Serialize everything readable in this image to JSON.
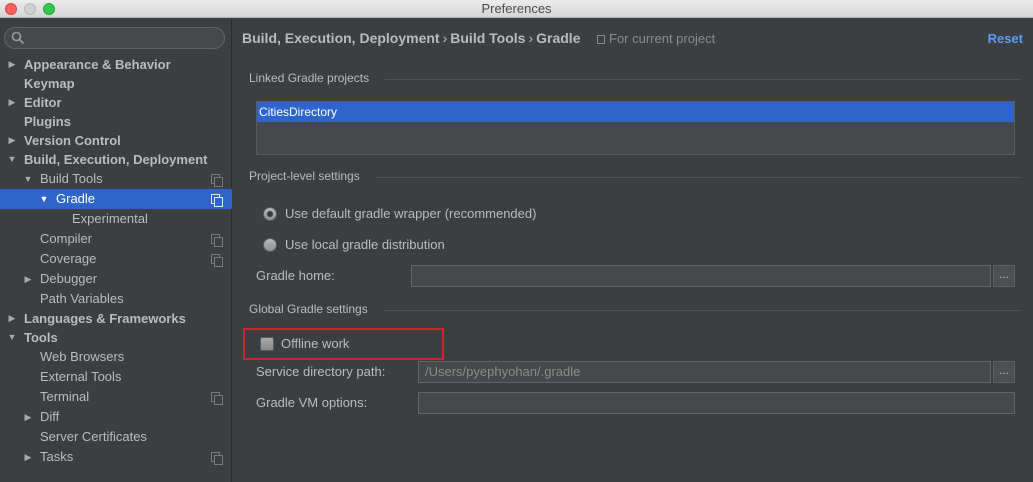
{
  "window": {
    "title": "Preferences"
  },
  "search": {
    "placeholder": "",
    "icon": "search-icon"
  },
  "sidebar": {
    "items": [
      {
        "label": "Appearance & Behavior",
        "bold": true,
        "arrow": "right",
        "indent": 0
      },
      {
        "label": "Keymap",
        "bold": true,
        "arrow": "",
        "indent": 0
      },
      {
        "label": "Editor",
        "bold": true,
        "arrow": "right",
        "indent": 0
      },
      {
        "label": "Plugins",
        "bold": true,
        "arrow": "",
        "indent": 0
      },
      {
        "label": "Version Control",
        "bold": true,
        "arrow": "right",
        "indent": 0
      },
      {
        "label": "Build, Execution, Deployment",
        "bold": true,
        "arrow": "down",
        "indent": 0
      },
      {
        "label": "Build Tools",
        "bold": false,
        "arrow": "down",
        "indent": 1,
        "copy": true
      },
      {
        "label": "Gradle",
        "bold": false,
        "arrow": "down",
        "indent": 2,
        "copy": true,
        "selected": true
      },
      {
        "label": "Experimental",
        "bold": false,
        "arrow": "",
        "indent": 3
      },
      {
        "label": "Compiler",
        "bold": false,
        "arrow": "",
        "indent": 1,
        "copy": true
      },
      {
        "label": "Coverage",
        "bold": false,
        "arrow": "",
        "indent": 1,
        "copy": true
      },
      {
        "label": "Debugger",
        "bold": false,
        "arrow": "right",
        "indent": 1
      },
      {
        "label": "Path Variables",
        "bold": false,
        "arrow": "",
        "indent": 1
      },
      {
        "label": "Languages & Frameworks",
        "bold": true,
        "arrow": "right",
        "indent": 0
      },
      {
        "label": "Tools",
        "bold": true,
        "arrow": "down",
        "indent": 0
      },
      {
        "label": "Web Browsers",
        "bold": false,
        "arrow": "",
        "indent": 1
      },
      {
        "label": "External Tools",
        "bold": false,
        "arrow": "",
        "indent": 1
      },
      {
        "label": "Terminal",
        "bold": false,
        "arrow": "",
        "indent": 1,
        "copy": true
      },
      {
        "label": "Diff",
        "bold": false,
        "arrow": "right",
        "indent": 1
      },
      {
        "label": "Server Certificates",
        "bold": false,
        "arrow": "",
        "indent": 1
      },
      {
        "label": "Tasks",
        "bold": false,
        "arrow": "right",
        "indent": 1,
        "copy": true
      }
    ]
  },
  "header": {
    "crumb1": "Build, Execution, Deployment",
    "crumb2": "Build Tools",
    "crumb3": "Gradle",
    "separator": "›",
    "scope": "For current project",
    "reset": "Reset"
  },
  "linked": {
    "title": "Linked Gradle projects",
    "projects": [
      "CitiesDirectory"
    ]
  },
  "project_level": {
    "title": "Project-level settings",
    "option_wrapper": "Use default gradle wrapper (recommended)",
    "option_local": "Use local gradle distribution",
    "selected": "wrapper",
    "gradle_home_label": "Gradle home:",
    "gradle_home_value": "",
    "browse": "..."
  },
  "global": {
    "title": "Global Gradle settings",
    "offline_label": "Offline work",
    "offline_checked": false,
    "service_dir_label": "Service directory path:",
    "service_dir_value": "/Users/pyephyohan/.gradle",
    "vm_options_label": "Gradle VM options:",
    "vm_options_value": "",
    "browse": "..."
  },
  "colors": {
    "accent": "#2f65ca",
    "link": "#589df6",
    "highlight_border": "#c8282a"
  }
}
